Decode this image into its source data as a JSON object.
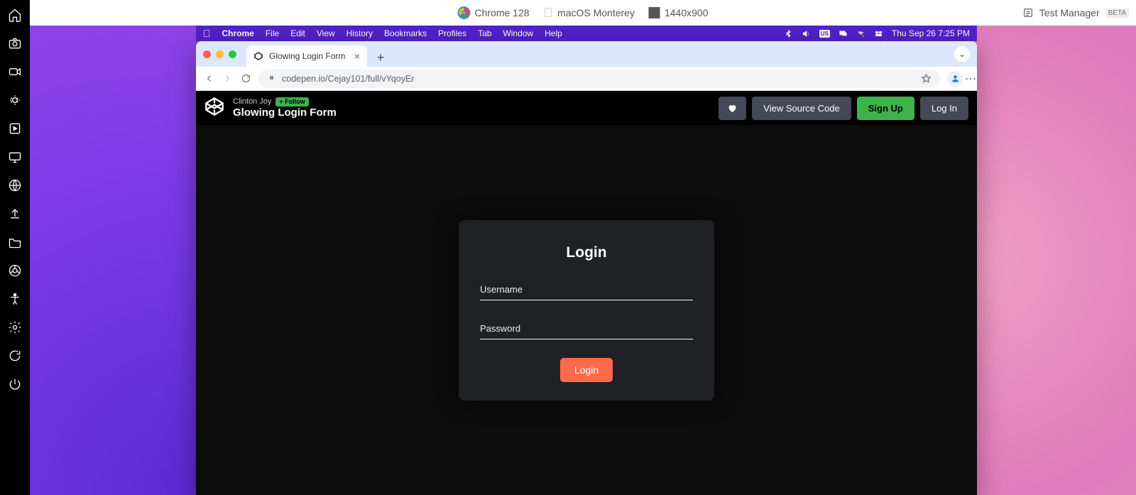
{
  "topbar": {
    "browser": "Chrome 128",
    "os": "macOS Monterey",
    "resolution": "1440x900",
    "test_manager": "Test Manager",
    "beta": "BETA"
  },
  "mac_menubar": {
    "app": "Chrome",
    "items": [
      "File",
      "Edit",
      "View",
      "History",
      "Bookmarks",
      "Profiles",
      "Tab",
      "Window",
      "Help"
    ],
    "input_badge": "US",
    "clock": "Thu Sep 26  7:25 PM"
  },
  "chrome": {
    "tab_title": "Glowing Login Form",
    "url": "codepen.io/Cejay101/full/vYqoyEr"
  },
  "codepen": {
    "author": "Clinton Joy",
    "follow": "+ Follow",
    "pen_title": "Glowing Login Form",
    "view_source": "View Source Code",
    "signup": "Sign Up",
    "login": "Log In"
  },
  "form": {
    "heading": "Login",
    "username_label": "Username",
    "password_label": "Password",
    "submit": "Login"
  }
}
